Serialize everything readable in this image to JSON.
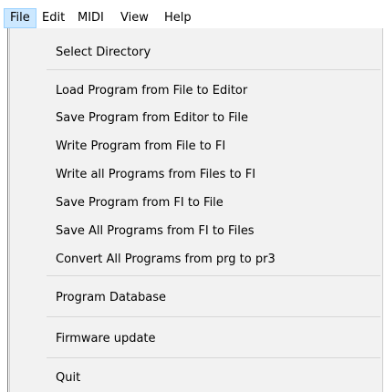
{
  "menubar": {
    "items": [
      {
        "label": "File"
      },
      {
        "label": "Edit"
      },
      {
        "label": "MIDI"
      },
      {
        "label": "View"
      },
      {
        "label": "Help"
      }
    ]
  },
  "file_menu": {
    "items": [
      {
        "label": "Select Directory"
      },
      {
        "label": "Load Program from File to Editor"
      },
      {
        "label": "Save Program from Editor to File"
      },
      {
        "label": "Write Program from File to FI"
      },
      {
        "label": "Write all Programs from Files to FI"
      },
      {
        "label": "Save Program from FI to File"
      },
      {
        "label": "Save All Programs from FI to Files"
      },
      {
        "label": "Convert All Programs from prg to pr3"
      },
      {
        "label": "Program Database"
      },
      {
        "label": "Firmware update"
      },
      {
        "label": "Quit"
      }
    ]
  }
}
